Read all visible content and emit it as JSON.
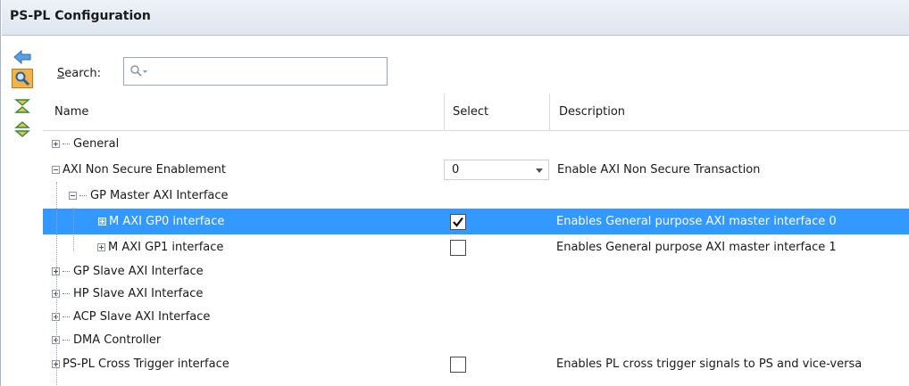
{
  "window": {
    "title": "PS-PL Configuration"
  },
  "search": {
    "label_underlined": "S",
    "label_rest": "earch:",
    "placeholder": "",
    "value": ""
  },
  "columns": {
    "name": "Name",
    "select": "Select",
    "description": "Description"
  },
  "rows": [
    {
      "name": "General",
      "description": ""
    },
    {
      "name": "AXI Non Secure Enablement",
      "select_value": "0",
      "description": "Enable AXI Non Secure Transaction"
    },
    {
      "name": "GP Master AXI Interface",
      "description": ""
    },
    {
      "name": "M AXI GP0 interface",
      "checked": true,
      "description": "Enables General purpose AXI master interface 0"
    },
    {
      "name": "M AXI GP1 interface",
      "checked": false,
      "description": "Enables General purpose AXI master interface 1"
    },
    {
      "name": "GP Slave AXI Interface",
      "description": ""
    },
    {
      "name": "HP Slave AXI Interface",
      "description": ""
    },
    {
      "name": "ACP Slave AXI Interface",
      "description": ""
    },
    {
      "name": "DMA Controller",
      "description": ""
    },
    {
      "name": "PS-PL Cross Trigger interface",
      "checked": false,
      "description": "Enables PL cross trigger signals to PS and vice-versa"
    }
  ],
  "colors": {
    "selection": "#3399ff",
    "titlebar": "#dfe6f0",
    "active_tool": "#f3b24a"
  }
}
